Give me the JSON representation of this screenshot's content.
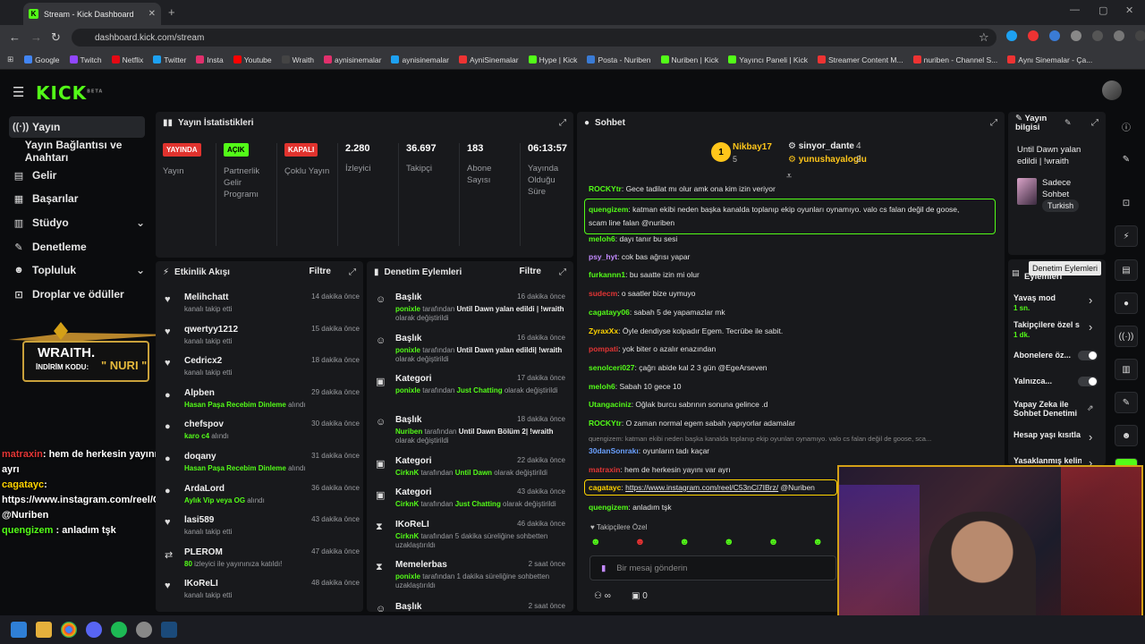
{
  "browser": {
    "tab_title": "Stream - Kick Dashboard",
    "url": "dashboard.kick.com/stream"
  },
  "bookmarks": [
    "Google",
    "Twitch",
    "Netflix",
    "Twitter",
    "Insta",
    "Youtube",
    "Wraith",
    "aynisinemalar",
    "aynisinemalar",
    "AyniSinemalar",
    "Hype | Kick",
    "Posta - Nuriben",
    "Nuriben | Kick",
    "Yayıncı Paneli | Kick",
    "Streamer Content M...",
    "nuriben - Channel S...",
    "Aynı Sinemalar - Ça..."
  ],
  "brand": {
    "logo": "KICK",
    "beta": "BETA"
  },
  "sidebar": {
    "items": [
      {
        "label": "Yayın"
      },
      {
        "label": "Yayın Bağlantısı ve Anahtarı"
      },
      {
        "label": "Gelir"
      },
      {
        "label": "Başarılar"
      },
      {
        "label": "Stüdyo"
      },
      {
        "label": "Denetleme"
      },
      {
        "label": "Topluluk"
      },
      {
        "label": "Droplar ve ödüller"
      }
    ]
  },
  "overlay": {
    "wraith_title": "WRAITH.",
    "wraith_code_label": "İNDİRİM KODU:",
    "wraith_code": "\" NURI \"",
    "chat": [
      {
        "user": "matraxin",
        "text": ": hem de herkesin yayını var ayrı"
      },
      {
        "user": "cagatayc",
        "text": ":"
      },
      {
        "user": "",
        "text": "https://www.instagram.com/reel/C53nCl7IBrz/"
      },
      {
        "user": "",
        "text": "@Nuriben"
      },
      {
        "user": "quengizem",
        "text": " : anladım tşk"
      }
    ]
  },
  "stats": {
    "title": "Yayın İstatistikleri",
    "cols": [
      {
        "badge": "YAYINDA",
        "label": "Yayın",
        "color": "#e1332e"
      },
      {
        "badge": "AÇIK",
        "label": "Partnerlik Gelir Programı",
        "color": "#53fc18"
      },
      {
        "badge": "KAPALI",
        "label": "Çoklu Yayın",
        "color": "#e1332e"
      },
      {
        "num": "2.280",
        "label": "İzleyici"
      },
      {
        "num": "36.697",
        "label": "Takipçi"
      },
      {
        "num": "183",
        "label": "Abone Sayısı"
      },
      {
        "num": "06:13:57",
        "label": "Yayında Olduğu Süre"
      }
    ]
  },
  "activity": {
    "title": "Etkinlik Akışı",
    "filter": "Filtre",
    "items": [
      {
        "user": "Melihchatt",
        "sub": "kanalı takip etti",
        "time": "14 dakika önce",
        "icon": "♥"
      },
      {
        "user": "qwertyy1212",
        "sub": "kanalı takip etti",
        "time": "15 dakika önce",
        "icon": "♥"
      },
      {
        "user": "Cedricx2",
        "sub": "kanalı takip etti",
        "time": "18 dakika önce",
        "icon": "♥"
      },
      {
        "user": "Alpben",
        "sub_green": "Hasan Paşa Recebim Dinleme",
        "sub": " alındı",
        "time": "29 dakika önce",
        "icon": "●"
      },
      {
        "user": "chefspov",
        "sub_green": "karo c4",
        "sub": " alındı",
        "time": "30 dakika önce",
        "icon": "●"
      },
      {
        "user": "doqany",
        "sub_green": "Hasan Paşa Recebim Dinleme",
        "sub": " alındı",
        "time": "31 dakika önce",
        "icon": "●"
      },
      {
        "user": "ArdaLord",
        "sub_green": "Aylık Vip veya OG",
        "sub": " alındı",
        "time": "36 dakika önce",
        "icon": "●"
      },
      {
        "user": "lasi589",
        "sub": "kanalı takip etti",
        "time": "43 dakika önce",
        "icon": "♥"
      },
      {
        "user": "PLEROM",
        "sub_green": "80",
        "sub": " izleyici ile yayınınıza katıldı!",
        "time": "47 dakika önce",
        "icon": "⇄"
      },
      {
        "user": "IKoReLI",
        "sub": "kanalı takip etti",
        "time": "48 dakika önce",
        "icon": "♥"
      }
    ]
  },
  "moderation": {
    "title": "Denetim Eylemleri",
    "filter": "Filtre",
    "items": [
      {
        "title": "Başlık",
        "by": "ponixle",
        "mid": " tarafından ",
        "val": "Until Dawn yalan edildi | !wraith",
        "end": " olarak değiştirildi",
        "time": "16 dakika önce",
        "icon": "☺"
      },
      {
        "title": "Başlık",
        "by": "ponixle",
        "mid": " tarafından ",
        "val": "Until Dawn yalan edildi| !wraith",
        "end": " olarak değiştirildi",
        "time": "16 dakika önce",
        "icon": "☺"
      },
      {
        "title": "Kategori",
        "by": "ponixle",
        "mid": " tarafından ",
        "val": "Just Chatting",
        "end": " olarak değiştirildi",
        "time": "17 dakika önce",
        "icon": "▣",
        "valgreen": true
      },
      {
        "title": "Başlık",
        "by": "Nuriben",
        "mid": " tarafından ",
        "val": "Until Dawn Bölüm 2| !wraith",
        "end": " olarak değiştirildi",
        "time": "18 dakika önce",
        "icon": "☺"
      },
      {
        "title": "Kategori",
        "by": "CirknK",
        "mid": " tarafından ",
        "val": "Until Dawn",
        "end": " olarak değiştirildi",
        "time": "22 dakika önce",
        "icon": "▣",
        "valgreen": true
      },
      {
        "title": "Kategori",
        "by": "CirknK",
        "mid": " tarafından ",
        "val": "Just Chatting",
        "end": " olarak değiştirildi",
        "time": "43 dakika önce",
        "icon": "▣",
        "valgreen": true
      },
      {
        "title": "IKoReLI",
        "by": "CirknK",
        "mid": " tarafından 5 dakika süreliğine sohbetten uzaklaştırıldı",
        "val": "",
        "end": "",
        "time": "46 dakika önce",
        "icon": "⧗"
      },
      {
        "title": "Memelerbas",
        "by": "ponixle",
        "mid": " tarafından 1 dakika süreliğine sohbetten uzaklaştırıldı",
        "val": "",
        "end": "",
        "time": "2 saat önce",
        "icon": "⧗"
      },
      {
        "title": "Başlık",
        "by": "",
        "mid": "",
        "val": "",
        "end": "",
        "time": "2 saat önce",
        "icon": "☺"
      }
    ]
  },
  "chat": {
    "title": "Sohbet",
    "leaders": [
      {
        "name": "Nikbay17",
        "count": "5",
        "rank": "1"
      },
      {
        "name": "sinyor_dante",
        "count": "4"
      },
      {
        "name": "yunushayaloglu",
        "count": "2"
      }
    ],
    "messages": [
      {
        "user": "ROCKYtr",
        "color": "#53fc18",
        "text": ": Gece tadilat mı olur amk ona kim izin veriyor"
      },
      {
        "user": "quengizem",
        "color": "#53fc18",
        "text": ": katman ekibi neden başka kanalda toplanıp ekip oyunları oynamıyo. valo cs falan değil de goose,",
        "text2": "scam line falan @nuriben",
        "boxed": true
      },
      {
        "user": "meloh6",
        "color": "#53fc18",
        "text": ": dayı tanır bu sesi"
      },
      {
        "user": "psy_hyt",
        "color": "#c38aff",
        "text": ": cok bas ağrısı yapar"
      },
      {
        "user": "furkannn1",
        "color": "#53fc18",
        "text": ": bu saatte izin mi olur"
      },
      {
        "user": "sudecm",
        "color": "#e33535",
        "text": ": o saatler bize uymuyo"
      },
      {
        "user": "cagatayy06",
        "color": "#53fc18",
        "text": ": sabah 5 de yapamazlar mk"
      },
      {
        "user": "ZyraxXx",
        "color": "#ffd400",
        "text": ": Öyle dendiyse kolpadır Egem. Tecrübe ile sabit."
      },
      {
        "user": "pompati",
        "color": "#e33535",
        "text": ": yok biter o azalır enazından"
      },
      {
        "user": "senolceri027",
        "color": "#53fc18",
        "text": ": çağrı abide kal 2 3 gün @EgeArseven"
      },
      {
        "user": "meloh6",
        "color": "#53fc18",
        "text": ": Sabah 10 gece 10"
      },
      {
        "user": "Utangaciniz",
        "color": "#53fc18",
        "text": ": Oğlak burcu sabrının sonuna gelince .d"
      },
      {
        "user": "ROCKYtr",
        "color": "#53fc18",
        "text": ": O zaman normal egem sabah yapıyorlar adamalar"
      },
      {
        "user": "30danSonrakı",
        "color": "#6aa0ff",
        "text": ": oyunların tadı kaçar",
        "reply": "quengizem: katman ekibi neden başka kanalda toplanıp ekip oyunları oynamıyo. valo cs falan değil de goose, sca..."
      },
      {
        "user": "matraxin",
        "color": "#e33535",
        "text": ": hem de herkesin yayını var ayrı"
      },
      {
        "user": "cagatayc",
        "color": "#ffd400",
        "text": ": ",
        "link": "https://www.instagram.com/reel/C53nCl7IBrz/",
        "tail": " @Nuriben",
        "boxed2": true
      },
      {
        "user": "quengizem",
        "color": "#53fc18",
        "text": ": anladım tşk"
      }
    ],
    "followers_only": "Takipçilere Özel",
    "placeholder": "Bir mesaj gönderin",
    "count": "0"
  },
  "stream_info": {
    "title": "Yayın bilgisi",
    "stream_title": "Until Dawn yalan edildi | !wraith",
    "category": "Sadece Sohbet",
    "language": "Turkish"
  },
  "mod_actions": {
    "title": "Eylemleri",
    "tooltip": "Denetim Eylemleri",
    "items": [
      {
        "label": "Yavaş mod",
        "sub": "1 sn."
      },
      {
        "label": "Takipçilere özel s",
        "sub": "1 dk."
      },
      {
        "label": "Abonelere öz..."
      },
      {
        "label": "Yalnızca..."
      },
      {
        "label": "Yapay Zeka ile Sohbet Denetimi"
      },
      {
        "label": "Hesap yaşı kısıtla"
      },
      {
        "label": "Yasaklanmış kelin"
      }
    ]
  }
}
